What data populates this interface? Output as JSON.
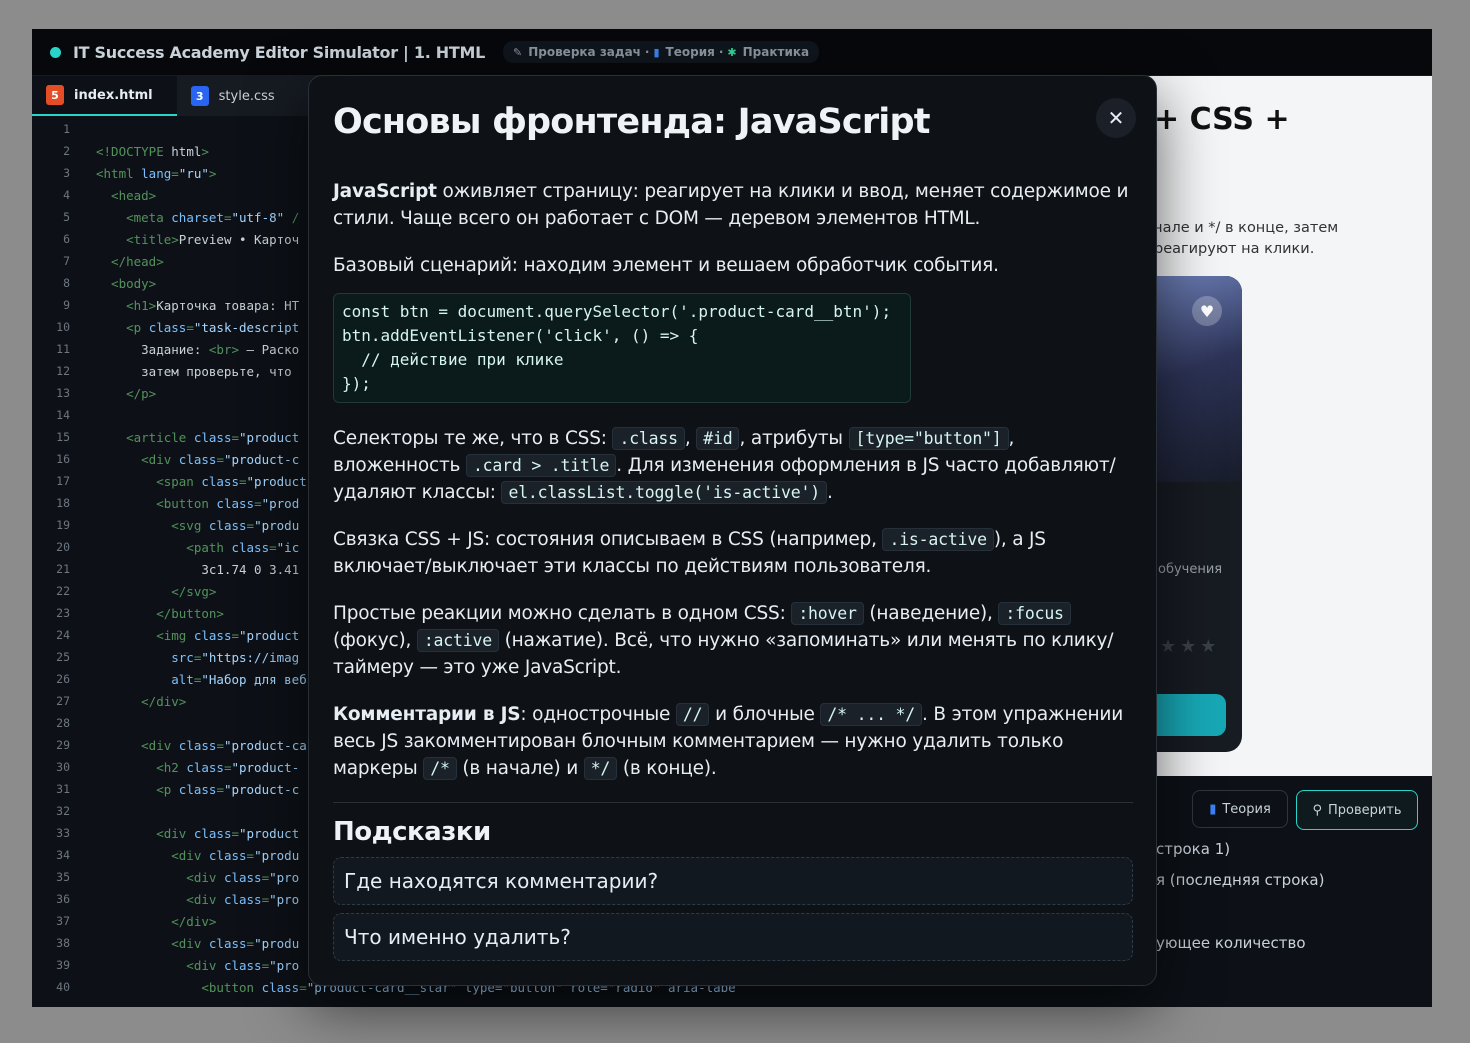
{
  "app": {
    "title": "IT Success Academy Editor Simulator | 1. HTML",
    "crumbs": [
      "Проверка задач",
      "Теория",
      "Практика"
    ],
    "sep": "·"
  },
  "tabs": [
    {
      "icon": "5",
      "label": "index.html"
    },
    {
      "icon": "3",
      "label": "style.css"
    }
  ],
  "code_lines": [
    [
      {
        "t": "",
        "c": "lt"
      }
    ],
    [
      {
        "t": "<!DOCTYPE ",
        "c": "tg"
      },
      {
        "t": "html",
        "c": "lt"
      },
      {
        "t": ">",
        "c": "tg"
      }
    ],
    [
      {
        "t": "<html ",
        "c": "tg"
      },
      {
        "t": "lang",
        "c": "at"
      },
      {
        "t": "=",
        "c": "tg"
      },
      {
        "t": "\"ru\"",
        "c": "st"
      },
      {
        "t": ">",
        "c": "tg"
      }
    ],
    [
      {
        "t": "  <head>",
        "c": "tg"
      }
    ],
    [
      {
        "t": "    <meta ",
        "c": "tg"
      },
      {
        "t": "charset",
        "c": "at"
      },
      {
        "t": "=",
        "c": "tg"
      },
      {
        "t": "\"utf-8\"",
        "c": "st"
      },
      {
        "t": " /",
        "c": "tg"
      }
    ],
    [
      {
        "t": "    <title>",
        "c": "tg"
      },
      {
        "t": "Preview • Карточ",
        "c": "lt"
      }
    ],
    [
      {
        "t": "  </head>",
        "c": "tg"
      }
    ],
    [
      {
        "t": "  <body>",
        "c": "tg"
      }
    ],
    [
      {
        "t": "    <h1>",
        "c": "tg"
      },
      {
        "t": "Карточка товара: HT",
        "c": "lt"
      }
    ],
    [
      {
        "t": "    <p ",
        "c": "tg"
      },
      {
        "t": "class",
        "c": "at"
      },
      {
        "t": "=",
        "c": "tg"
      },
      {
        "t": "\"task-descript",
        "c": "st"
      }
    ],
    [
      {
        "t": "      Задание: ",
        "c": "lt"
      },
      {
        "t": "<br>",
        "c": "tg"
      },
      {
        "t": " — Раско",
        "c": "lt"
      }
    ],
    [
      {
        "t": "      затем проверьте, что",
        "c": "lt"
      }
    ],
    [
      {
        "t": "    </p>",
        "c": "tg"
      }
    ],
    [
      {
        "t": "",
        "c": "lt"
      }
    ],
    [
      {
        "t": "    <article ",
        "c": "tg"
      },
      {
        "t": "class",
        "c": "at"
      },
      {
        "t": "=",
        "c": "tg"
      },
      {
        "t": "\"product",
        "c": "st"
      }
    ],
    [
      {
        "t": "      <div ",
        "c": "tg"
      },
      {
        "t": "class",
        "c": "at"
      },
      {
        "t": "=",
        "c": "tg"
      },
      {
        "t": "\"product-c",
        "c": "st"
      }
    ],
    [
      {
        "t": "        <span ",
        "c": "tg"
      },
      {
        "t": "class",
        "c": "at"
      },
      {
        "t": "=",
        "c": "tg"
      },
      {
        "t": "\"product",
        "c": "st"
      }
    ],
    [
      {
        "t": "        <button ",
        "c": "tg"
      },
      {
        "t": "class",
        "c": "at"
      },
      {
        "t": "=",
        "c": "tg"
      },
      {
        "t": "\"prod",
        "c": "st"
      }
    ],
    [
      {
        "t": "          <svg ",
        "c": "tg"
      },
      {
        "t": "class",
        "c": "at"
      },
      {
        "t": "=",
        "c": "tg"
      },
      {
        "t": "\"produ",
        "c": "st"
      }
    ],
    [
      {
        "t": "            <path ",
        "c": "tg"
      },
      {
        "t": "class",
        "c": "at"
      },
      {
        "t": "=",
        "c": "tg"
      },
      {
        "t": "\"ic",
        "c": "st"
      }
    ],
    [
      {
        "t": "              3c1.74 0 3.41",
        "c": "lt"
      }
    ],
    [
      {
        "t": "          </svg>",
        "c": "tg"
      }
    ],
    [
      {
        "t": "        </button>",
        "c": "tg"
      }
    ],
    [
      {
        "t": "        <img ",
        "c": "tg"
      },
      {
        "t": "class",
        "c": "at"
      },
      {
        "t": "=",
        "c": "tg"
      },
      {
        "t": "\"product",
        "c": "st"
      }
    ],
    [
      {
        "t": "          src",
        "c": "at"
      },
      {
        "t": "=",
        "c": "tg"
      },
      {
        "t": "\"https://imag",
        "c": "st"
      }
    ],
    [
      {
        "t": "          alt",
        "c": "at"
      },
      {
        "t": "=",
        "c": "tg"
      },
      {
        "t": "\"Набор для веб",
        "c": "st"
      }
    ],
    [
      {
        "t": "      </div>",
        "c": "tg"
      }
    ],
    [
      {
        "t": "",
        "c": "lt"
      }
    ],
    [
      {
        "t": "      <div ",
        "c": "tg"
      },
      {
        "t": "class",
        "c": "at"
      },
      {
        "t": "=",
        "c": "tg"
      },
      {
        "t": "\"product-ca",
        "c": "st"
      }
    ],
    [
      {
        "t": "        <h2 ",
        "c": "tg"
      },
      {
        "t": "class",
        "c": "at"
      },
      {
        "t": "=",
        "c": "tg"
      },
      {
        "t": "\"product-",
        "c": "st"
      }
    ],
    [
      {
        "t": "        <p ",
        "c": "tg"
      },
      {
        "t": "class",
        "c": "at"
      },
      {
        "t": "=",
        "c": "tg"
      },
      {
        "t": "\"product-c",
        "c": "st"
      }
    ],
    [
      {
        "t": "",
        "c": "lt"
      }
    ],
    [
      {
        "t": "        <div ",
        "c": "tg"
      },
      {
        "t": "class",
        "c": "at"
      },
      {
        "t": "=",
        "c": "tg"
      },
      {
        "t": "\"product",
        "c": "st"
      }
    ],
    [
      {
        "t": "          <div ",
        "c": "tg"
      },
      {
        "t": "class",
        "c": "at"
      },
      {
        "t": "=",
        "c": "tg"
      },
      {
        "t": "\"produ",
        "c": "st"
      }
    ],
    [
      {
        "t": "            <div ",
        "c": "tg"
      },
      {
        "t": "class",
        "c": "at"
      },
      {
        "t": "=",
        "c": "tg"
      },
      {
        "t": "\"pro",
        "c": "st"
      }
    ],
    [
      {
        "t": "            <div ",
        "c": "tg"
      },
      {
        "t": "class",
        "c": "at"
      },
      {
        "t": "=",
        "c": "tg"
      },
      {
        "t": "\"pro",
        "c": "st"
      }
    ],
    [
      {
        "t": "          </div>",
        "c": "tg"
      }
    ],
    [
      {
        "t": "          <div ",
        "c": "tg"
      },
      {
        "t": "class",
        "c": "at"
      },
      {
        "t": "=",
        "c": "tg"
      },
      {
        "t": "\"produ",
        "c": "st"
      }
    ],
    [
      {
        "t": "            <div ",
        "c": "tg"
      },
      {
        "t": "class",
        "c": "at"
      },
      {
        "t": "=",
        "c": "tg"
      },
      {
        "t": "\"pro",
        "c": "st"
      }
    ],
    [
      {
        "t": "              <button ",
        "c": "tg"
      },
      {
        "t": "class",
        "c": "at"
      },
      {
        "t": "=",
        "c": "tg"
      },
      {
        "t": "\"product-card__star\" type=\"button\" role=\"radio\" aria-labe",
        "c": "st"
      }
    ]
  ],
  "preview": {
    "title": "+ CSS +",
    "desc_line1": "чале и */ в конце, затем",
    "desc_line2": "реагируют на клики.",
    "card_meta": "обучения",
    "card_stars": "★★★",
    "heart": "♥"
  },
  "bottom": {
    "theory_label": "Теория",
    "check_label": "Проверить",
    "lines": [
      "строка 1)",
      "я (последняя строка)",
      "ующее количество"
    ]
  },
  "modal": {
    "title": "Основы фронтенда: JavaScript",
    "close": "✕",
    "p1_bold": "JavaScript",
    "p1_rest": " оживляет страницу: реагирует на клики и ввод, меняет содержимое и стили. Чаще всего он работает с DOM — деревом элементов HTML.",
    "p2": "Базовый сценарий: находим элемент и вешаем обработчик события.",
    "codeblock": "const btn = document.querySelector('.product-card__btn');\nbtn.addEventListener('click', () => {\n  // действие при клике\n});",
    "p3": {
      "t1": "Селекторы те же, что в CSS: ",
      "c1": ".class",
      "t2": ", ",
      "c2": "#id",
      "t3": ", атрибуты ",
      "c3": "[type=\"button\"]",
      "t4": ", вложенность ",
      "c4": ".card > .title",
      "t5": ". Для изменения оформления в JS часто добавляют/удаляют классы: ",
      "c5": "el.classList.toggle('is-active')",
      "t6": "."
    },
    "p4": {
      "t1": "Связка CSS + JS: состояния описываем в CSS (например, ",
      "c1": ".is-active",
      "t2": "), а JS включает/выключает эти классы по действиям пользователя."
    },
    "p5": {
      "t1": "Простые реакции можно сделать в одном CSS: ",
      "c1": ":hover",
      "t2": " (наведение), ",
      "c2": ":focus",
      "t3": " (фокус), ",
      "c3": ":active",
      "t4": " (нажатие). Всё, что нужно «запоминать» или менять по клику/таймеру — это уже JavaScript."
    },
    "p6": {
      "b": "Комментарии в JS",
      "t1": ": однострочные ",
      "c1": "//",
      "t2": " и блочные ",
      "c2": "/* ... */",
      "t3": ". В этом упражнении весь JS закомментирован блочным комментарием — нужно удалить только маркеры ",
      "c3": "/*",
      "t4": " (в начале) и ",
      "c4": "*/",
      "t5": " (в конце)."
    },
    "hints_title": "Подсказки",
    "hints": [
      "Где находятся комментарии?",
      "Что именно удалить?"
    ]
  },
  "colors": {
    "accent": "#2bd4c9",
    "html_badge": "#e44d26",
    "css_badge": "#2965f1"
  }
}
